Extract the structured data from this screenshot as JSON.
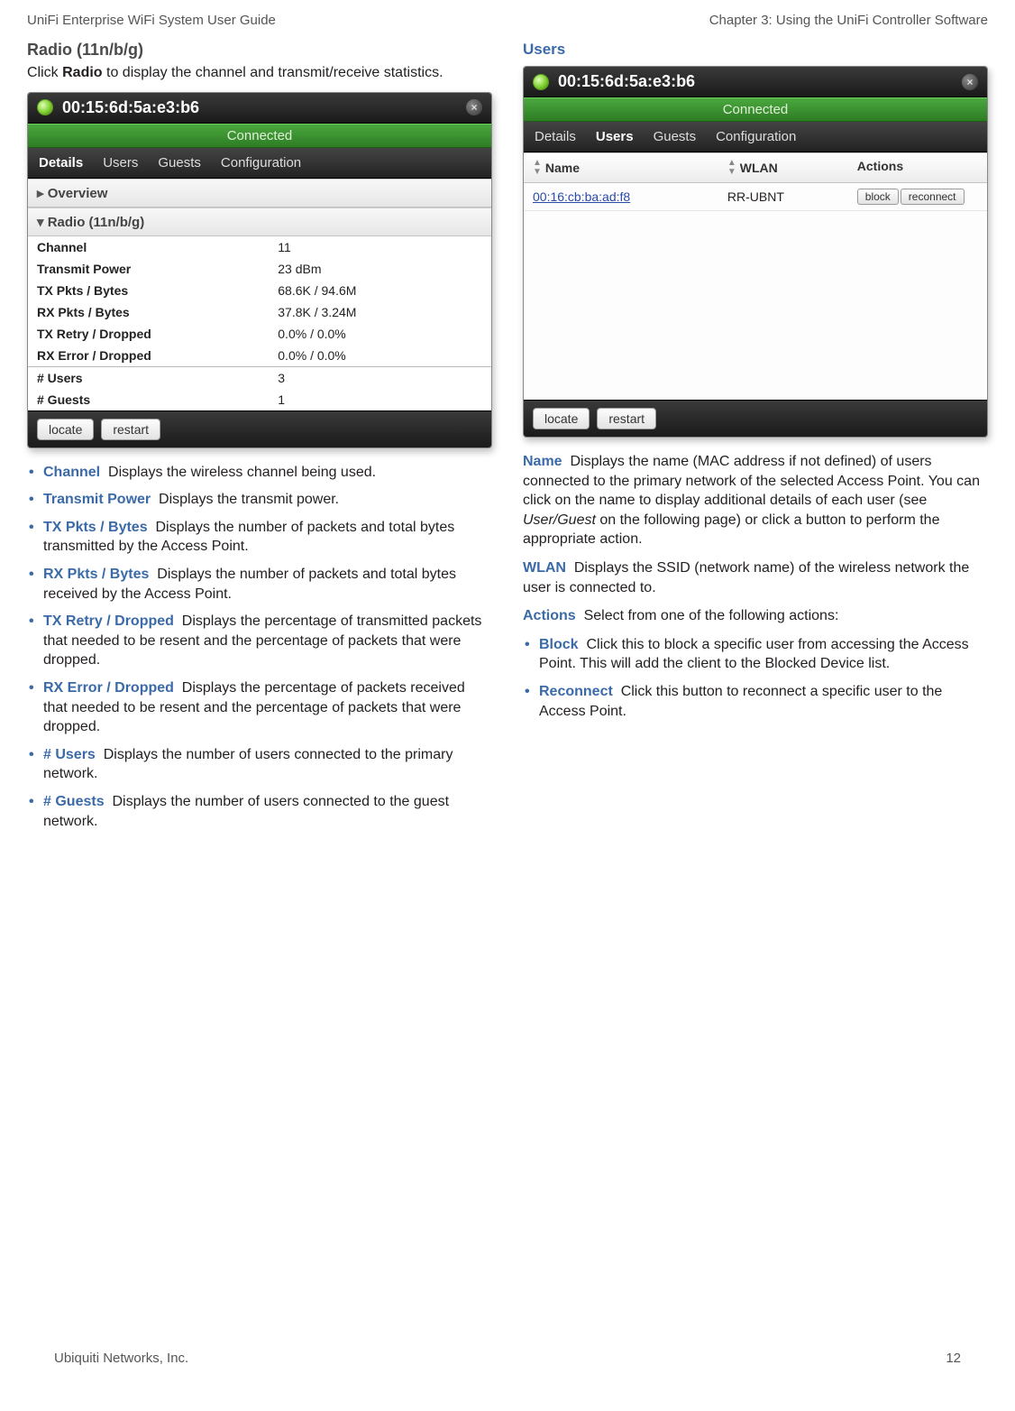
{
  "header": {
    "left": "UniFi Enterprise WiFi System User Guide",
    "right": "Chapter 3: Using the UniFi Controller Software"
  },
  "footer": {
    "company": "Ubiquiti Networks, Inc.",
    "page": "12"
  },
  "left": {
    "heading": "Radio (11n/b/g)",
    "intro_pre": "Click ",
    "intro_bold": "Radio",
    "intro_post": " to display the channel and transmit/receive statistics.",
    "shot": {
      "title": "00:15:6d:5a:e3:b6",
      "status": "Connected",
      "tabs": [
        "Details",
        "Users",
        "Guests",
        "Configuration"
      ],
      "active_tab": 0,
      "accordion": {
        "overview": "Overview",
        "radio": "Radio (11n/b/g)"
      },
      "stats": [
        {
          "label": "Channel",
          "value": "11"
        },
        {
          "label": "Transmit Power",
          "value": "23 dBm"
        },
        {
          "label": "TX Pkts / Bytes",
          "value": "68.6K / 94.6M"
        },
        {
          "label": "RX Pkts / Bytes",
          "value": "37.8K / 3.24M"
        },
        {
          "label": "TX Retry / Dropped",
          "value": "0.0% / 0.0%"
        },
        {
          "label": "RX Error / Dropped",
          "value": "0.0% / 0.0%"
        }
      ],
      "stats2": [
        {
          "label": "# Users",
          "value": "3"
        },
        {
          "label": "# Guests",
          "value": "1"
        }
      ],
      "footer": {
        "locate": "locate",
        "restart": "restart"
      }
    },
    "bullets": [
      {
        "term": "Channel",
        "text": "Displays the wireless channel being used."
      },
      {
        "term": "Transmit Power",
        "text": "Displays the transmit power."
      },
      {
        "term": "TX Pkts / Bytes",
        "text": "Displays the number of packets and total bytes transmitted by the Access Point."
      },
      {
        "term": "RX Pkts / Bytes",
        "text": "Displays the number of packets and total bytes received by the Access Point."
      },
      {
        "term": "TX Retry / Dropped",
        "text": "Displays the percentage of transmitted packets that needed to be resent and the percentage of packets that were dropped."
      },
      {
        "term": "RX Error / Dropped",
        "text": "Displays the percentage of packets received that needed to be resent and the percentage of packets that were dropped."
      },
      {
        "term": "# Users",
        "text": "Displays the number of users connected to the primary network."
      },
      {
        "term": "# Guests",
        "text": "Displays the number of users connected to the guest network."
      }
    ]
  },
  "right": {
    "heading": "Users",
    "shot": {
      "title": "00:15:6d:5a:e3:b6",
      "status": "Connected",
      "tabs": [
        "Details",
        "Users",
        "Guests",
        "Configuration"
      ],
      "active_tab": 1,
      "columns": {
        "name": "Name",
        "wlan": "WLAN",
        "actions": "Actions"
      },
      "rows": [
        {
          "name": "00:16:cb:ba:ad:f8",
          "wlan": "RR-UBNT",
          "block": "block",
          "reconnect": "reconnect"
        }
      ],
      "footer": {
        "locate": "locate",
        "restart": "restart"
      }
    },
    "name": {
      "term": "Name",
      "pre": "Displays the name (MAC address if not defined) of users connected to the primary network of the selected Access Point. You can click on the name to display additional details of each user (see ",
      "italic": "User/Guest",
      "post": " on the following page) or click a button to perform the appropriate action."
    },
    "wlan": {
      "term": "WLAN",
      "text": "Displays the SSID (network name) of the wireless network the user is connected to."
    },
    "actions": {
      "term": "Actions",
      "text": "Select from one of the following actions:"
    },
    "bullets": [
      {
        "term": "Block",
        "text": "Click this to block a specific user from accessing the Access Point. This will add the client to the Blocked Device list."
      },
      {
        "term": "Reconnect",
        "text": "Click this button to reconnect a specific user to the Access Point."
      }
    ]
  }
}
